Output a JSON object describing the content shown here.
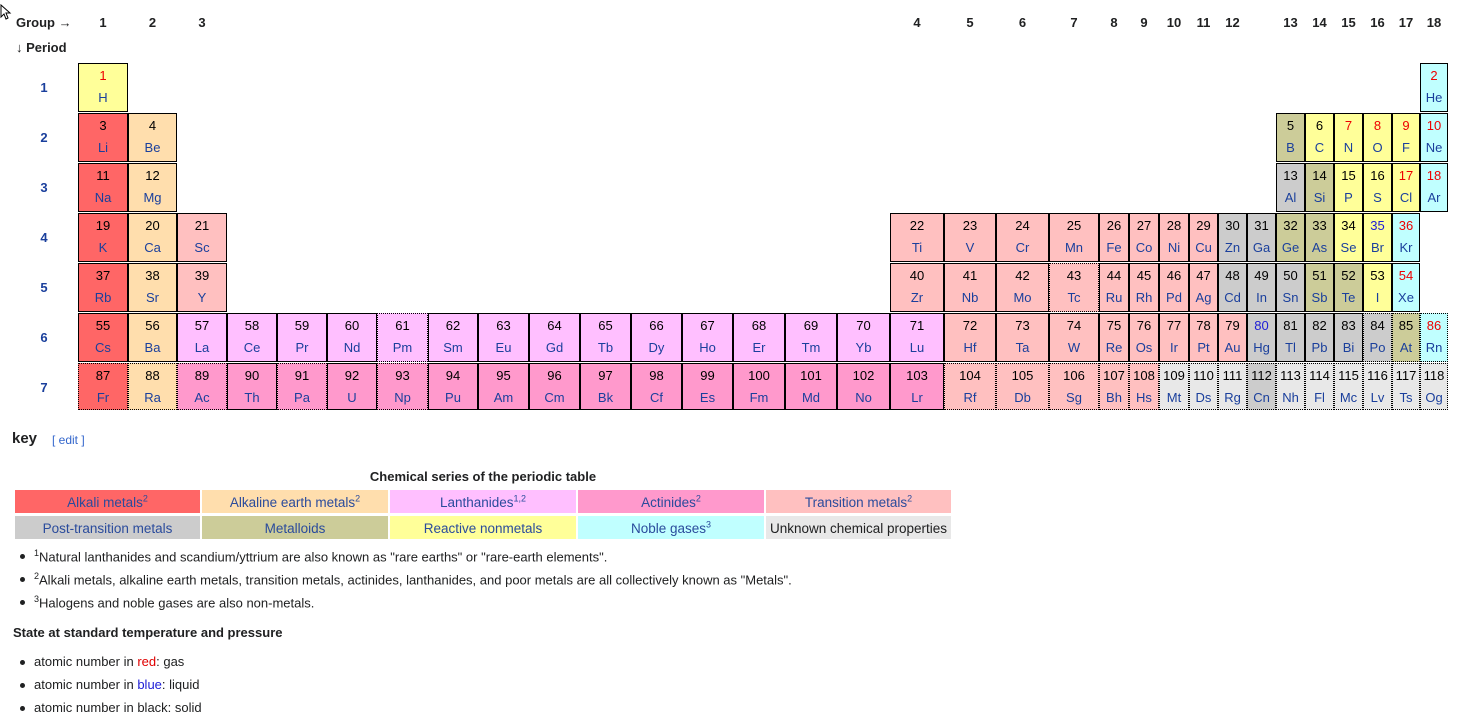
{
  "header": {
    "group_label": "Group →",
    "period_label": "↓ Period"
  },
  "group_numbers": [
    "1",
    "2",
    "3",
    "4",
    "5",
    "6",
    "7",
    "8",
    "9",
    "10",
    "11",
    "12",
    "13",
    "14",
    "15",
    "16",
    "17",
    "18"
  ],
  "period_numbers": [
    "1",
    "2",
    "3",
    "4",
    "5",
    "6",
    "7"
  ],
  "colors": {
    "alkali": "#ff6666",
    "alkaline": "#ffdead",
    "lanthanide": "#ffbfff",
    "actinide": "#ff99cc",
    "transition": "#ffc0c0",
    "post": "#cccccc",
    "metalloid": "#cccc99",
    "nonmetal": "#ffff99",
    "noble": "#c0ffff",
    "unknown": "#e8e8e8"
  },
  "elements": [
    {
      "n": "1",
      "s": "H",
      "c": "nonmetal",
      "st": "gas"
    },
    {
      "n": "2",
      "s": "He",
      "c": "noble",
      "st": "gas"
    },
    {
      "n": "3",
      "s": "Li",
      "c": "alkali",
      "st": "solid"
    },
    {
      "n": "4",
      "s": "Be",
      "c": "alkaline",
      "st": "solid"
    },
    {
      "n": "5",
      "s": "B",
      "c": "metalloid",
      "st": "solid"
    },
    {
      "n": "6",
      "s": "C",
      "c": "nonmetal",
      "st": "solid"
    },
    {
      "n": "7",
      "s": "N",
      "c": "nonmetal",
      "st": "gas"
    },
    {
      "n": "8",
      "s": "O",
      "c": "nonmetal",
      "st": "gas"
    },
    {
      "n": "9",
      "s": "F",
      "c": "nonmetal",
      "st": "gas"
    },
    {
      "n": "10",
      "s": "Ne",
      "c": "noble",
      "st": "gas"
    },
    {
      "n": "11",
      "s": "Na",
      "c": "alkali",
      "st": "solid"
    },
    {
      "n": "12",
      "s": "Mg",
      "c": "alkaline",
      "st": "solid"
    },
    {
      "n": "13",
      "s": "Al",
      "c": "post",
      "st": "solid"
    },
    {
      "n": "14",
      "s": "Si",
      "c": "metalloid",
      "st": "solid"
    },
    {
      "n": "15",
      "s": "P",
      "c": "nonmetal",
      "st": "solid"
    },
    {
      "n": "16",
      "s": "S",
      "c": "nonmetal",
      "st": "solid"
    },
    {
      "n": "17",
      "s": "Cl",
      "c": "nonmetal",
      "st": "gas"
    },
    {
      "n": "18",
      "s": "Ar",
      "c": "noble",
      "st": "gas"
    },
    {
      "n": "19",
      "s": "K",
      "c": "alkali",
      "st": "solid"
    },
    {
      "n": "20",
      "s": "Ca",
      "c": "alkaline",
      "st": "solid"
    },
    {
      "n": "21",
      "s": "Sc",
      "c": "transition",
      "st": "solid"
    },
    {
      "n": "22",
      "s": "Ti",
      "c": "transition",
      "st": "solid"
    },
    {
      "n": "23",
      "s": "V",
      "c": "transition",
      "st": "solid"
    },
    {
      "n": "24",
      "s": "Cr",
      "c": "transition",
      "st": "solid"
    },
    {
      "n": "25",
      "s": "Mn",
      "c": "transition",
      "st": "solid"
    },
    {
      "n": "26",
      "s": "Fe",
      "c": "transition",
      "st": "solid"
    },
    {
      "n": "27",
      "s": "Co",
      "c": "transition",
      "st": "solid"
    },
    {
      "n": "28",
      "s": "Ni",
      "c": "transition",
      "st": "solid"
    },
    {
      "n": "29",
      "s": "Cu",
      "c": "transition",
      "st": "solid"
    },
    {
      "n": "30",
      "s": "Zn",
      "c": "post",
      "st": "solid"
    },
    {
      "n": "31",
      "s": "Ga",
      "c": "post",
      "st": "solid"
    },
    {
      "n": "32",
      "s": "Ge",
      "c": "metalloid",
      "st": "solid"
    },
    {
      "n": "33",
      "s": "As",
      "c": "metalloid",
      "st": "solid"
    },
    {
      "n": "34",
      "s": "Se",
      "c": "nonmetal",
      "st": "solid"
    },
    {
      "n": "35",
      "s": "Br",
      "c": "nonmetal",
      "st": "liquid"
    },
    {
      "n": "36",
      "s": "Kr",
      "c": "noble",
      "st": "gas"
    },
    {
      "n": "37",
      "s": "Rb",
      "c": "alkali",
      "st": "solid"
    },
    {
      "n": "38",
      "s": "Sr",
      "c": "alkaline",
      "st": "solid"
    },
    {
      "n": "39",
      "s": "Y",
      "c": "transition",
      "st": "solid"
    },
    {
      "n": "40",
      "s": "Zr",
      "c": "transition",
      "st": "solid"
    },
    {
      "n": "41",
      "s": "Nb",
      "c": "transition",
      "st": "solid"
    },
    {
      "n": "42",
      "s": "Mo",
      "c": "transition",
      "st": "solid"
    },
    {
      "n": "43",
      "s": "Tc",
      "c": "transition",
      "st": "solid",
      "syn": true
    },
    {
      "n": "44",
      "s": "Ru",
      "c": "transition",
      "st": "solid"
    },
    {
      "n": "45",
      "s": "Rh",
      "c": "transition",
      "st": "solid"
    },
    {
      "n": "46",
      "s": "Pd",
      "c": "transition",
      "st": "solid"
    },
    {
      "n": "47",
      "s": "Ag",
      "c": "transition",
      "st": "solid"
    },
    {
      "n": "48",
      "s": "Cd",
      "c": "post",
      "st": "solid"
    },
    {
      "n": "49",
      "s": "In",
      "c": "post",
      "st": "solid"
    },
    {
      "n": "50",
      "s": "Sn",
      "c": "post",
      "st": "solid"
    },
    {
      "n": "51",
      "s": "Sb",
      "c": "metalloid",
      "st": "solid"
    },
    {
      "n": "52",
      "s": "Te",
      "c": "metalloid",
      "st": "solid"
    },
    {
      "n": "53",
      "s": "I",
      "c": "nonmetal",
      "st": "solid"
    },
    {
      "n": "54",
      "s": "Xe",
      "c": "noble",
      "st": "gas"
    },
    {
      "n": "55",
      "s": "Cs",
      "c": "alkali",
      "st": "solid"
    },
    {
      "n": "56",
      "s": "Ba",
      "c": "alkaline",
      "st": "solid"
    },
    {
      "n": "57",
      "s": "La",
      "c": "lanthanide",
      "st": "solid"
    },
    {
      "n": "58",
      "s": "Ce",
      "c": "lanthanide",
      "st": "solid"
    },
    {
      "n": "59",
      "s": "Pr",
      "c": "lanthanide",
      "st": "solid"
    },
    {
      "n": "60",
      "s": "Nd",
      "c": "lanthanide",
      "st": "solid"
    },
    {
      "n": "61",
      "s": "Pm",
      "c": "lanthanide",
      "st": "solid",
      "syn": true
    },
    {
      "n": "62",
      "s": "Sm",
      "c": "lanthanide",
      "st": "solid"
    },
    {
      "n": "63",
      "s": "Eu",
      "c": "lanthanide",
      "st": "solid"
    },
    {
      "n": "64",
      "s": "Gd",
      "c": "lanthanide",
      "st": "solid"
    },
    {
      "n": "65",
      "s": "Tb",
      "c": "lanthanide",
      "st": "solid"
    },
    {
      "n": "66",
      "s": "Dy",
      "c": "lanthanide",
      "st": "solid"
    },
    {
      "n": "67",
      "s": "Ho",
      "c": "lanthanide",
      "st": "solid"
    },
    {
      "n": "68",
      "s": "Er",
      "c": "lanthanide",
      "st": "solid"
    },
    {
      "n": "69",
      "s": "Tm",
      "c": "lanthanide",
      "st": "solid"
    },
    {
      "n": "70",
      "s": "Yb",
      "c": "lanthanide",
      "st": "solid"
    },
    {
      "n": "71",
      "s": "Lu",
      "c": "lanthanide",
      "st": "solid"
    },
    {
      "n": "72",
      "s": "Hf",
      "c": "transition",
      "st": "solid"
    },
    {
      "n": "73",
      "s": "Ta",
      "c": "transition",
      "st": "solid"
    },
    {
      "n": "74",
      "s": "W",
      "c": "transition",
      "st": "solid"
    },
    {
      "n": "75",
      "s": "Re",
      "c": "transition",
      "st": "solid"
    },
    {
      "n": "76",
      "s": "Os",
      "c": "transition",
      "st": "solid"
    },
    {
      "n": "77",
      "s": "Ir",
      "c": "transition",
      "st": "solid"
    },
    {
      "n": "78",
      "s": "Pt",
      "c": "transition",
      "st": "solid"
    },
    {
      "n": "79",
      "s": "Au",
      "c": "transition",
      "st": "solid"
    },
    {
      "n": "80",
      "s": "Hg",
      "c": "post",
      "st": "liquid"
    },
    {
      "n": "81",
      "s": "Tl",
      "c": "post",
      "st": "solid"
    },
    {
      "n": "82",
      "s": "Pb",
      "c": "post",
      "st": "solid"
    },
    {
      "n": "83",
      "s": "Bi",
      "c": "post",
      "st": "solid"
    },
    {
      "n": "84",
      "s": "Po",
      "c": "post",
      "st": "solid",
      "syn": true
    },
    {
      "n": "85",
      "s": "At",
      "c": "metalloid",
      "st": "solid",
      "syn": true
    },
    {
      "n": "86",
      "s": "Rn",
      "c": "noble",
      "st": "gas",
      "syn": true
    },
    {
      "n": "87",
      "s": "Fr",
      "c": "alkali",
      "st": "solid",
      "syn": true
    },
    {
      "n": "88",
      "s": "Ra",
      "c": "alkaline",
      "st": "solid",
      "syn": true
    },
    {
      "n": "89",
      "s": "Ac",
      "c": "actinide",
      "st": "solid",
      "syn": true
    },
    {
      "n": "90",
      "s": "Th",
      "c": "actinide",
      "st": "solid"
    },
    {
      "n": "91",
      "s": "Pa",
      "c": "actinide",
      "st": "solid",
      "syn": true
    },
    {
      "n": "92",
      "s": "U",
      "c": "actinide",
      "st": "solid"
    },
    {
      "n": "93",
      "s": "Np",
      "c": "actinide",
      "st": "solid",
      "syn": true
    },
    {
      "n": "94",
      "s": "Pu",
      "c": "actinide",
      "st": "solid"
    },
    {
      "n": "95",
      "s": "Am",
      "c": "actinide",
      "st": "solid"
    },
    {
      "n": "96",
      "s": "Cm",
      "c": "actinide",
      "st": "solid"
    },
    {
      "n": "97",
      "s": "Bk",
      "c": "actinide",
      "st": "solid"
    },
    {
      "n": "98",
      "s": "Cf",
      "c": "actinide",
      "st": "solid"
    },
    {
      "n": "99",
      "s": "Es",
      "c": "actinide",
      "st": "solid"
    },
    {
      "n": "100",
      "s": "Fm",
      "c": "actinide",
      "st": "solid"
    },
    {
      "n": "101",
      "s": "Md",
      "c": "actinide",
      "st": "solid"
    },
    {
      "n": "102",
      "s": "No",
      "c": "actinide",
      "st": "solid"
    },
    {
      "n": "103",
      "s": "Lr",
      "c": "actinide",
      "st": "solid"
    },
    {
      "n": "104",
      "s": "Rf",
      "c": "transition",
      "st": "solid",
      "syn": true
    },
    {
      "n": "105",
      "s": "Db",
      "c": "transition",
      "st": "solid",
      "syn": true
    },
    {
      "n": "106",
      "s": "Sg",
      "c": "transition",
      "st": "solid",
      "syn": true
    },
    {
      "n": "107",
      "s": "Bh",
      "c": "transition",
      "st": "solid",
      "syn": true
    },
    {
      "n": "108",
      "s": "Hs",
      "c": "transition",
      "st": "solid",
      "syn": true
    },
    {
      "n": "109",
      "s": "Mt",
      "c": "unknown",
      "st": "solid",
      "syn": true
    },
    {
      "n": "110",
      "s": "Ds",
      "c": "unknown",
      "st": "solid",
      "syn": true
    },
    {
      "n": "111",
      "s": "Rg",
      "c": "unknown",
      "st": "solid",
      "syn": true
    },
    {
      "n": "112",
      "s": "Cn",
      "c": "post",
      "st": "solid",
      "syn": true
    },
    {
      "n": "113",
      "s": "Nh",
      "c": "unknown",
      "st": "solid",
      "syn": true
    },
    {
      "n": "114",
      "s": "Fl",
      "c": "unknown",
      "st": "solid",
      "syn": true
    },
    {
      "n": "115",
      "s": "Mc",
      "c": "unknown",
      "st": "solid",
      "syn": true
    },
    {
      "n": "116",
      "s": "Lv",
      "c": "unknown",
      "st": "solid",
      "syn": true
    },
    {
      "n": "117",
      "s": "Ts",
      "c": "unknown",
      "st": "solid",
      "syn": true
    },
    {
      "n": "118",
      "s": "Og",
      "c": "unknown",
      "st": "solid",
      "syn": true
    }
  ],
  "key": {
    "heading": "key",
    "edit": "[ edit ]",
    "title": "Chemical series of the periodic table",
    "items": [
      {
        "label": "Alkali metals",
        "sup": "2",
        "c": "alkali"
      },
      {
        "label": "Alkaline earth metals",
        "sup": "2",
        "c": "alkaline"
      },
      {
        "label": "Lanthanides",
        "sup": "1,2",
        "c": "lanthanide"
      },
      {
        "label": "Actinides",
        "sup": "2",
        "c": "actinide"
      },
      {
        "label": "Transition metals",
        "sup": "2",
        "c": "transition"
      },
      {
        "label": "Post-transition metals",
        "sup": "",
        "c": "post"
      },
      {
        "label": "Metalloids",
        "sup": "",
        "c": "metalloid"
      },
      {
        "label": "Reactive nonmetals",
        "sup": "",
        "c": "nonmetal"
      },
      {
        "label": "Noble gases",
        "sup": "3",
        "c": "noble"
      },
      {
        "label": "Unknown chemical properties",
        "sup": "",
        "c": "unknown"
      }
    ]
  },
  "notes": [
    {
      "sup": "1",
      "text": "Natural lanthanides and scandium/yttrium are also known as \"rare earths\" or \"rare-earth elements\"."
    },
    {
      "sup": "2",
      "text": "Alkali metals, alkaline earth metals, transition metals, actinides, lanthanides, and poor metals are all collectively known as \"Metals\"."
    },
    {
      "sup": "3",
      "text": "Halogens and noble gases are also non-metals."
    }
  ],
  "state": {
    "heading": "State at standard temperature and pressure",
    "items": [
      {
        "pre": "atomic number in ",
        "word": "red",
        "post": ": gas",
        "color": "#e00000"
      },
      {
        "pre": "atomic number in ",
        "word": "blue",
        "post": ": liquid",
        "color": "#1d1dd6"
      },
      {
        "pre": "atomic number in black: solid",
        "word": "",
        "post": "",
        "color": "#202122"
      }
    ]
  }
}
